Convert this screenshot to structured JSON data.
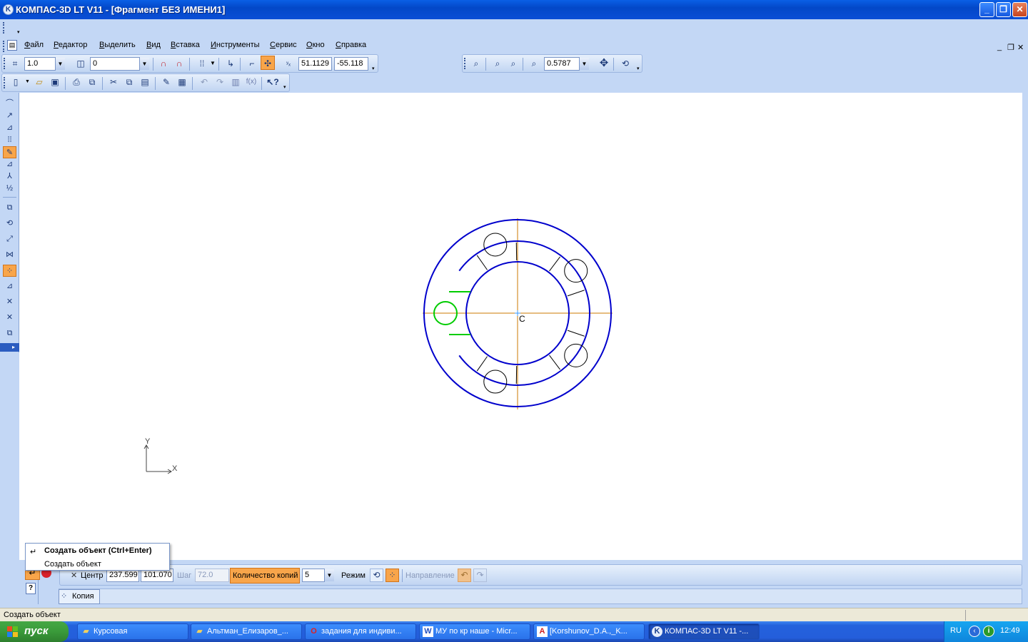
{
  "window": {
    "title": "КОМПАС-3D LT V11 - [Фрагмент БЕЗ ИМЕНИ1]",
    "app_icon": "K",
    "controls": {
      "minimize": "_",
      "restore": "❐",
      "close": "✕"
    }
  },
  "menu": {
    "items": [
      "Файл",
      "Редактор",
      "Выделить",
      "Вид",
      "Вставка",
      "Инструменты",
      "Сервис",
      "Окно",
      "Справка"
    ],
    "mdi_controls": [
      "_",
      "❐",
      "✕"
    ]
  },
  "current_params_toolbar": {
    "step": "1.0",
    "layer": "0",
    "coord_x": "51.1129",
    "coord_y": "-55.118"
  },
  "view_toolbar": {
    "zoom": "0.5787"
  },
  "drawing": {
    "colors": {
      "contour": "#0000cc",
      "axis": "#cc7a00",
      "selected": "#00cc00",
      "thin": "#000000"
    },
    "center_label": "C",
    "axis_labels": {
      "x": "X",
      "y": "Y"
    }
  },
  "tooltip": {
    "title": "Создать объект (Ctrl+Enter)",
    "subtitle": "Создать объект"
  },
  "property_panel": {
    "center_label": "Центр",
    "center_x": "237.599",
    "center_y": "101.070",
    "step_label": "Шаг",
    "step_value": "72.0",
    "copies_label": "Количество копий",
    "copies_value": "5",
    "mode_label": "Режим",
    "direction_label": "Направление",
    "tab_label": "Копия"
  },
  "statusbar": {
    "text": "Создать объект"
  },
  "taskbar": {
    "start_label": "пуск",
    "tasks": [
      {
        "label": "Курсовая",
        "icon": "folder-icon"
      },
      {
        "label": "Альтман_Елизаров_...",
        "icon": "folder-icon"
      },
      {
        "label": "задания для индиви...",
        "icon": "opera-icon"
      },
      {
        "label": "МУ по кр наше - Micr...",
        "icon": "word-icon"
      },
      {
        "label": "[Korshunov_D.A.,_K...",
        "icon": "pdf-icon"
      },
      {
        "label": "КОМПАС-3D LT V11 -...",
        "icon": "kompas-icon"
      }
    ],
    "tray": {
      "lang": "RU",
      "time": "12:49"
    }
  }
}
